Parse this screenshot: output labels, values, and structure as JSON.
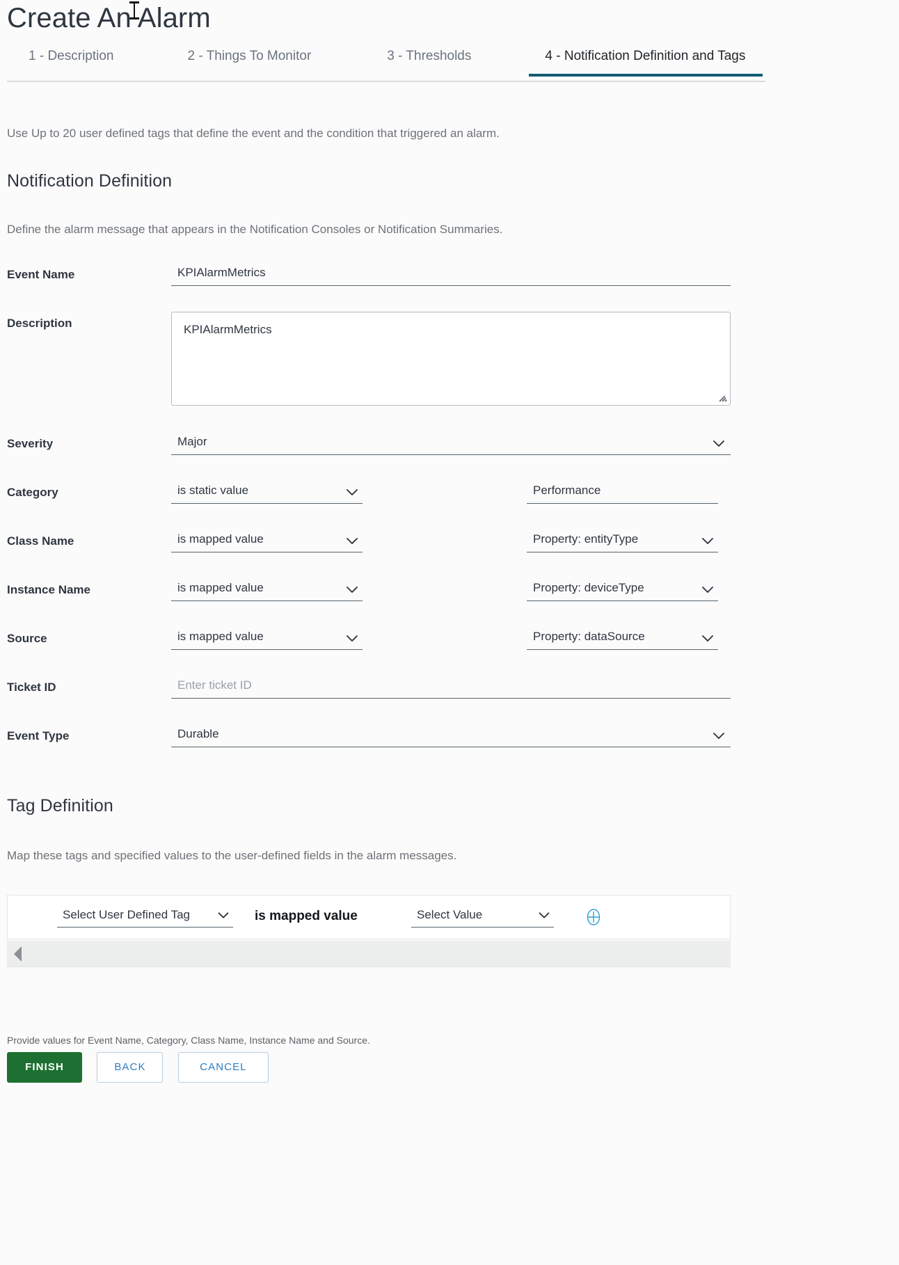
{
  "header": {
    "title": "Create An Alarm",
    "tabs": [
      {
        "label": "1 - Description",
        "active": false
      },
      {
        "label": "2 - Things To Monitor",
        "active": false
      },
      {
        "label": "3 - Thresholds",
        "active": false
      },
      {
        "label": "4 - Notification Definition and Tags",
        "active": true
      }
    ],
    "active_tab_color": "#125c73"
  },
  "intro": "Use Up to 20 user defined tags that define the event and the condition that triggered an alarm.",
  "notification": {
    "section_title": "Notification Definition",
    "section_subtitle": "Define the alarm message that appears in the Notification Consoles or Notification Summaries.",
    "event_name": {
      "label": "Event Name",
      "value": "KPIAlarmMetrics"
    },
    "description": {
      "label": "Description",
      "value": "KPIAlarmMetrics"
    },
    "severity": {
      "label": "Severity",
      "value": "Major"
    },
    "category": {
      "label": "Category",
      "mode": "is static value",
      "value": "Performance"
    },
    "class_name": {
      "label": "Class Name",
      "mode": "is mapped value",
      "value": "Property: entityType"
    },
    "instance_name": {
      "label": "Instance Name",
      "mode": "is mapped value",
      "value": "Property: deviceType"
    },
    "source": {
      "label": "Source",
      "mode": "is mapped value",
      "value": "Property: dataSource"
    },
    "ticket_id": {
      "label": "Ticket ID",
      "value": "",
      "placeholder": "Enter ticket ID"
    },
    "event_type": {
      "label": "Event Type",
      "value": "Durable"
    }
  },
  "tags": {
    "section_title": "Tag Definition",
    "section_subtitle": "Map these tags and specified values to the user-defined fields in the alarm messages.",
    "row": {
      "tag_select": "Select User Defined Tag",
      "operator": "is mapped value",
      "value_select": "Select Value",
      "add_icon": "plus-circle-icon",
      "add_icon_color": "#2e9fd4"
    },
    "scroll_left_icon": "scroll-left-arrow-icon"
  },
  "footer": {
    "validation_message": "Provide values for Event Name, Category, Class Name, Instance Name and Source.",
    "buttons": [
      {
        "label": "FINISH",
        "style": "primary",
        "color": "#1d7031"
      },
      {
        "label": "BACK",
        "style": "ghost"
      },
      {
        "label": "CANCEL",
        "style": "ghost"
      }
    ]
  }
}
